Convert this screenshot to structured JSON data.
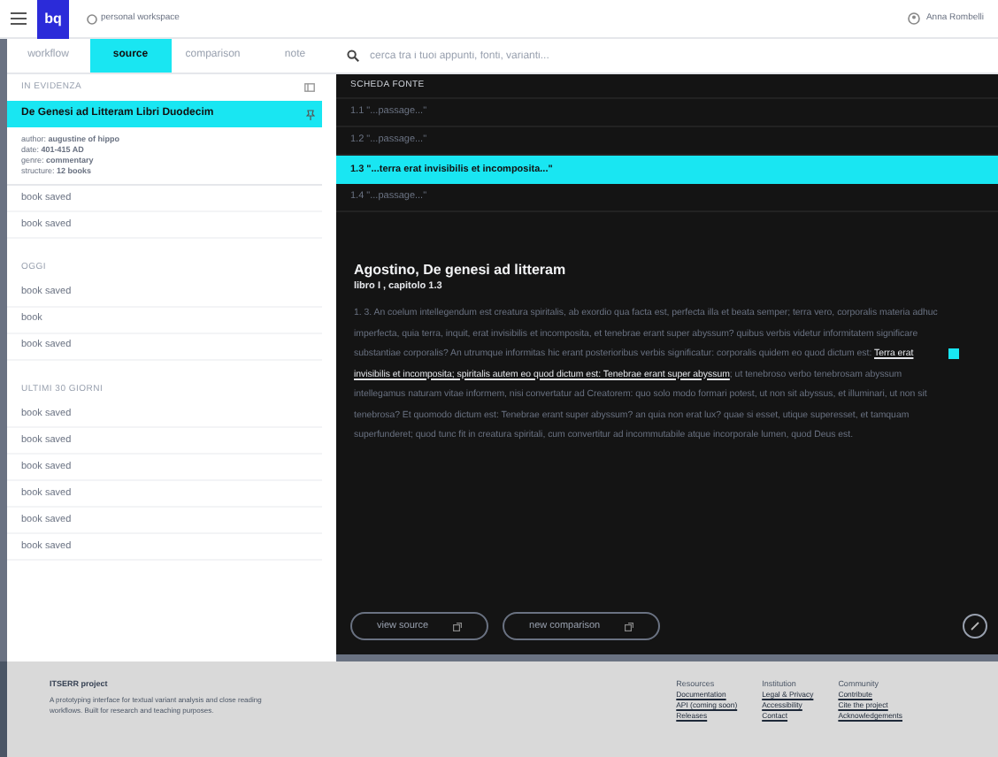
{
  "topbar": {
    "logo": "bq",
    "workspace": "personal workspace",
    "user": "Anna Rombelli"
  },
  "tabs": [
    {
      "label": "workflow",
      "selected": false
    },
    {
      "label": "source",
      "selected": true
    },
    {
      "label": "comparison",
      "selected": false
    },
    {
      "label": "note",
      "selected": false
    }
  ],
  "search": {
    "placeholder": "cerca tra i tuoi appunti, fonti, varianti..."
  },
  "sidebar": {
    "featured_heading": "IN EVIDENZA",
    "featured": {
      "title": "De Genesi ad Litteram Libri Duodecim",
      "selected": true,
      "meta": [
        "author: **augustine of hippo**",
        "date: **401-415 AD**",
        "genre: **commentary**",
        "structure: **12 books**"
      ]
    },
    "sections": [
      {
        "items": [
          "book saved",
          "book saved"
        ]
      },
      {
        "heading": "OGGI",
        "items": [
          "book saved",
          "book",
          "book saved"
        ]
      },
      {
        "heading": "ULTIMI 30 GIORNI",
        "items": [
          "book saved",
          "book saved",
          "book saved",
          "book saved",
          "book saved",
          "book saved"
        ]
      }
    ]
  },
  "source_card": {
    "heading": "SCHEDA FONTE",
    "passages": [
      {
        "label": "1.1 \"...passage...\"",
        "selected": false
      },
      {
        "label": "1.2 \"...passage...\"",
        "selected": false
      },
      {
        "label": "1.3 \"...terra erat invisibilis et incomposita...\"",
        "selected": true
      },
      {
        "label": "1.4 \"...passage...\"",
        "selected": false
      }
    ],
    "title": "Agostino, De genesi ad litteram",
    "subtitle": "libro I , capitolo 1.3",
    "paragraph": {
      "before": "1. 3. An coelum intellegendum est creatura spiritalis, ab exordio qua facta est, perfecta illa et beata semper; terra vero, corporalis materia adhuc imperfecta, quia terra, inquit, erat invisibilis et incomposita, et tenebrae erant super abyssum? quibus verbis videtur informitatem significare substantiae corporalis? An utrumque informitas hic erant posterioribus verbis significatur: corporalis quidem eo quod dictum est:",
      "underlined": "Terra erat invisibilis et incomposita; spiritalis autem eo quod dictum est: Tenebrae erant super abyssum",
      "after": "; ut tenebroso verbo tenebrosam abyssum intellegamus naturam vitae informem, nisi convertatur ad Creatorem: quo solo modo formari potest, ut non sit abyssus, et illuminari, ut non sit tenebrosa? Et quomodo dictum est: Tenebrae erant super abyssum? an quia non erat lux? quae si esset, utique superesset, et tamquam superfunderet; quod tunc fit in creatura spiritali, cum convertitur ad incommutabile atque incorporale lumen, quod Deus est."
    },
    "buttons": [
      "view source",
      "new comparison"
    ]
  },
  "footer": {
    "title": "ITSERR project",
    "description": "A prototyping interface for textual variant analysis and close reading workflows. Built for research and teaching purposes.",
    "columns": [
      {
        "heading": "Resources",
        "links": [
          "Documentation",
          "API (coming soon)",
          "Releases"
        ]
      },
      {
        "heading": "Institution",
        "links": [
          "Legal & Privacy",
          "Accessibility",
          "Contact"
        ]
      },
      {
        "heading": "Community",
        "links": [
          "Contribute",
          "Cite the project",
          "Acknowledgements"
        ]
      }
    ]
  }
}
